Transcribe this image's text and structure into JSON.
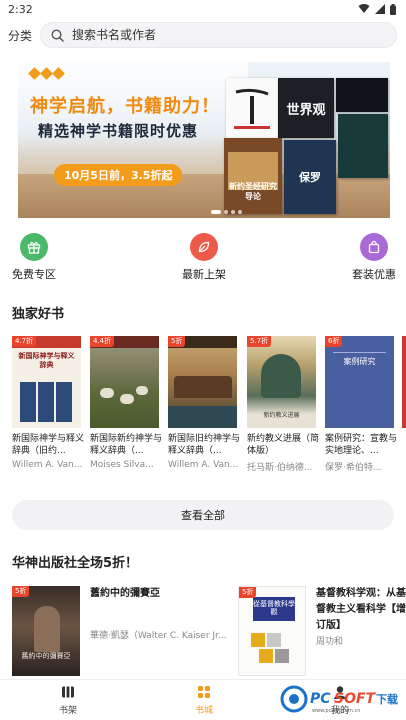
{
  "status_bar": {
    "time": "2:32"
  },
  "top_bar": {
    "category_label": "分类",
    "search_placeholder": "搜索书名或作者"
  },
  "banner": {
    "headline": "神学启航，书籍助力！",
    "subhead": "精选神学书籍限时优惠",
    "pill": "10月5日前，3.5折起",
    "cover_texts": [
      "世界观",
      "新约圣经研究导论",
      "保罗"
    ]
  },
  "quick_links": [
    {
      "label": "免费专区",
      "icon": "gift-icon",
      "color": "#4cb86a"
    },
    {
      "label": "最新上架",
      "icon": "leaf-icon",
      "color": "#ee5a4a"
    },
    {
      "label": "套装优惠",
      "icon": "shopping-bag-icon",
      "color": "#a86ad6"
    }
  ],
  "exclusive": {
    "title": "独家好书",
    "books": [
      {
        "badge": "4.7折",
        "title": "新国际神学与释义辞典（旧约...",
        "author": "Willem A. Van...",
        "cover_color": "#f4f0e6",
        "cover_text": "新国际神学与释义辞典"
      },
      {
        "badge": "4.4折",
        "title": "新国际新约神学与释义辞典（...",
        "author": "Moises Silva...",
        "cover_color": "#6b7a4a",
        "cover_text": ""
      },
      {
        "badge": "5折",
        "title": "新国际旧约神学与释义辞典（...",
        "author": "Willem A. Van...",
        "cover_color": "#8c6a44",
        "cover_text": ""
      },
      {
        "badge": "5.7折",
        "title": "新约教义进展（简体版）",
        "author": "托马斯·伯纳德...",
        "cover_color": "#5a6e5a",
        "cover_text": "新约教义进展"
      },
      {
        "badge": "6折",
        "title": "案例研究：宣教与实地理论、...",
        "author": "保罗·希伯特...",
        "cover_color": "#4a5fa0",
        "cover_text": "案例研究"
      }
    ]
  },
  "view_all_label": "查看全部",
  "promo": {
    "title": "华神出版社全场5折！",
    "books": [
      {
        "badge": "5折",
        "title": "舊約中的彌賽亞",
        "author": "華德·凱瑟（Walter C. Kaiser Jr....",
        "cover_text": "舊約中的彌賽亞"
      },
      {
        "badge": "5折",
        "title": "基督教科学观：从基督教主义看科学【增订版】",
        "author": "周功和",
        "cover_text": "從基督教科學觀"
      }
    ]
  },
  "tab_bar": {
    "tabs": [
      {
        "label": "书架",
        "icon": "bookshelf-icon",
        "active": false
      },
      {
        "label": "书城",
        "icon": "store-grid-icon",
        "active": true
      },
      {
        "label": "我的",
        "icon": "person-icon",
        "active": false
      }
    ]
  },
  "watermark": {
    "brand": "PCSOFT下载",
    "url": "www.pcsoft.com.cn"
  },
  "colors": {
    "accent": "#f39b1a",
    "badge": "#e8452c",
    "tab_active": "#f39b1a"
  }
}
